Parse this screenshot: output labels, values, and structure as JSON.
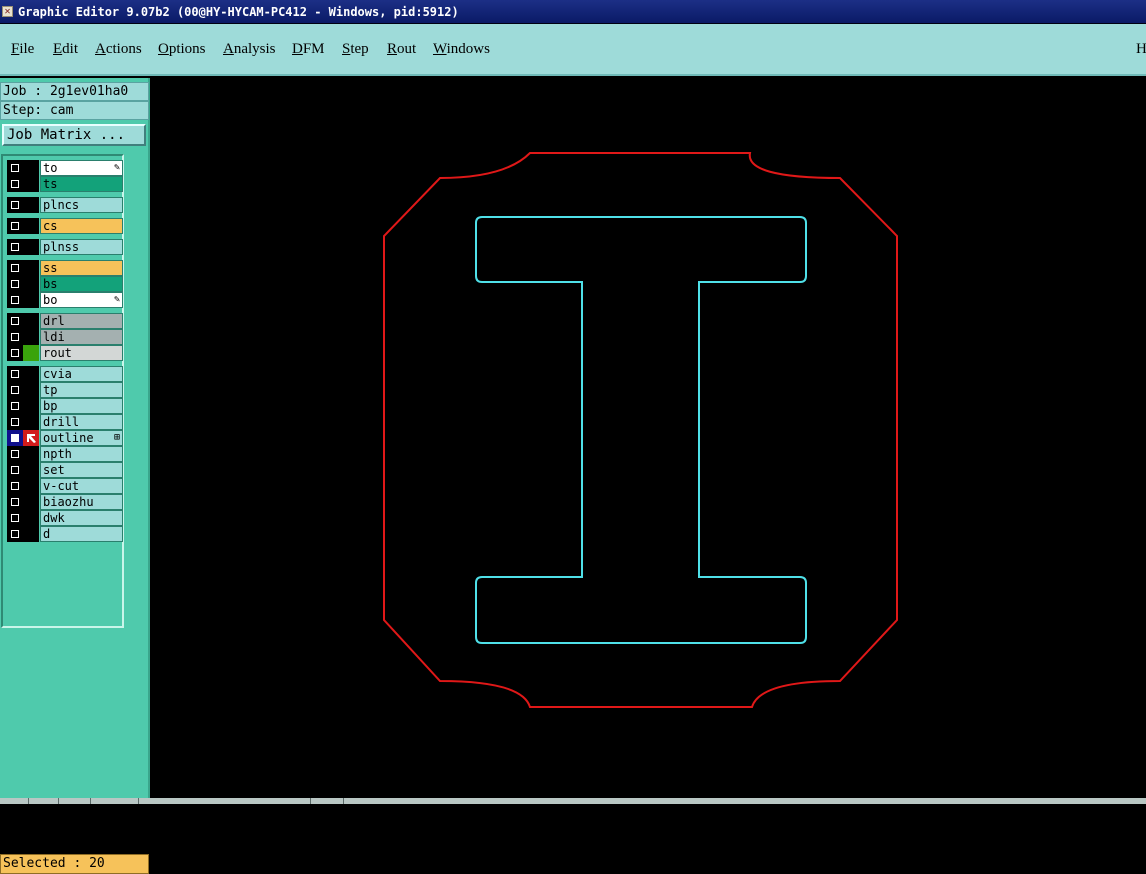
{
  "window": {
    "title": "Graphic Editor 9.07b2 (00@HY-HYCAM-PC412 - Windows, pid:5912)",
    "icon": "x-app-icon"
  },
  "menu": {
    "items": [
      "File",
      "Edit",
      "Actions",
      "Options",
      "Analysis",
      "DFM",
      "Step",
      "Rout",
      "Windows"
    ],
    "help": "H"
  },
  "job": {
    "job_line": "Job : 2g1ev01ha0",
    "step_line": "Step: cam",
    "matrix_button": "Job Matrix ..."
  },
  "layers": [
    {
      "name": "to",
      "color": "#ffffff",
      "active": false,
      "mark": "✎"
    },
    {
      "name": "ts",
      "color": "#13a27a",
      "active": false
    },
    {
      "name": "plncs",
      "color": "#9edbd9",
      "active": false
    },
    {
      "name": "cs",
      "color": "#f6c25a",
      "active": false
    },
    {
      "name": "plnss",
      "color": "#9edbd9",
      "active": false
    },
    {
      "name": "ss",
      "color": "#f6c25a",
      "active": false
    },
    {
      "name": "bs",
      "color": "#13a27a",
      "active": false
    },
    {
      "name": "bo",
      "color": "#ffffff",
      "active": false,
      "mark": "✎"
    },
    {
      "name": "drl",
      "color": "#a4b0b0",
      "active": false
    },
    {
      "name": "ldi",
      "color": "#a4b0b0",
      "active": false
    },
    {
      "name": "rout",
      "color": "#d3d7d6",
      "active": false,
      "swatch": "#3aa30c"
    },
    {
      "name": "cvia",
      "color": "#9edbd9",
      "active": false
    },
    {
      "name": "tp",
      "color": "#9edbd9",
      "active": false
    },
    {
      "name": "bp",
      "color": "#9edbd9",
      "active": false
    },
    {
      "name": "drill",
      "color": "#9edbd9",
      "active": false
    },
    {
      "name": "outline",
      "color": "#9edbd9",
      "active": true,
      "mark": "⊞"
    },
    {
      "name": "npth",
      "color": "#9edbd9",
      "active": false
    },
    {
      "name": "set",
      "color": "#9edbd9",
      "active": false
    },
    {
      "name": "v-cut",
      "color": "#9edbd9",
      "active": false
    },
    {
      "name": "biaozhu",
      "color": "#9edbd9",
      "active": false
    },
    {
      "name": "dwk",
      "color": "#9edbd9",
      "active": false
    },
    {
      "name": "d",
      "color": "#9edbd9",
      "active": false
    }
  ],
  "status": {
    "selected": "Selected : 20"
  },
  "canvas": {
    "outline_color": "#e01818",
    "profile_color": "#4fe0e8"
  }
}
